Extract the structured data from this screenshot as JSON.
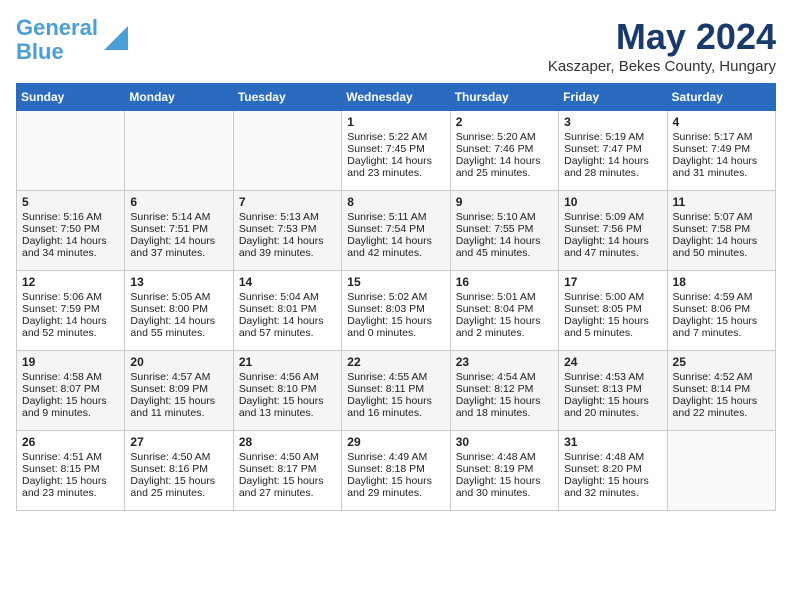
{
  "header": {
    "logo_line1": "General",
    "logo_line2": "Blue",
    "month_year": "May 2024",
    "location": "Kaszaper, Bekes County, Hungary"
  },
  "days_of_week": [
    "Sunday",
    "Monday",
    "Tuesday",
    "Wednesday",
    "Thursday",
    "Friday",
    "Saturday"
  ],
  "weeks": [
    [
      {
        "day": "",
        "sunrise": "",
        "sunset": "",
        "daylight": ""
      },
      {
        "day": "",
        "sunrise": "",
        "sunset": "",
        "daylight": ""
      },
      {
        "day": "",
        "sunrise": "",
        "sunset": "",
        "daylight": ""
      },
      {
        "day": "1",
        "sunrise": "Sunrise: 5:22 AM",
        "sunset": "Sunset: 7:45 PM",
        "daylight": "Daylight: 14 hours and 23 minutes."
      },
      {
        "day": "2",
        "sunrise": "Sunrise: 5:20 AM",
        "sunset": "Sunset: 7:46 PM",
        "daylight": "Daylight: 14 hours and 25 minutes."
      },
      {
        "day": "3",
        "sunrise": "Sunrise: 5:19 AM",
        "sunset": "Sunset: 7:47 PM",
        "daylight": "Daylight: 14 hours and 28 minutes."
      },
      {
        "day": "4",
        "sunrise": "Sunrise: 5:17 AM",
        "sunset": "Sunset: 7:49 PM",
        "daylight": "Daylight: 14 hours and 31 minutes."
      }
    ],
    [
      {
        "day": "5",
        "sunrise": "Sunrise: 5:16 AM",
        "sunset": "Sunset: 7:50 PM",
        "daylight": "Daylight: 14 hours and 34 minutes."
      },
      {
        "day": "6",
        "sunrise": "Sunrise: 5:14 AM",
        "sunset": "Sunset: 7:51 PM",
        "daylight": "Daylight: 14 hours and 37 minutes."
      },
      {
        "day": "7",
        "sunrise": "Sunrise: 5:13 AM",
        "sunset": "Sunset: 7:53 PM",
        "daylight": "Daylight: 14 hours and 39 minutes."
      },
      {
        "day": "8",
        "sunrise": "Sunrise: 5:11 AM",
        "sunset": "Sunset: 7:54 PM",
        "daylight": "Daylight: 14 hours and 42 minutes."
      },
      {
        "day": "9",
        "sunrise": "Sunrise: 5:10 AM",
        "sunset": "Sunset: 7:55 PM",
        "daylight": "Daylight: 14 hours and 45 minutes."
      },
      {
        "day": "10",
        "sunrise": "Sunrise: 5:09 AM",
        "sunset": "Sunset: 7:56 PM",
        "daylight": "Daylight: 14 hours and 47 minutes."
      },
      {
        "day": "11",
        "sunrise": "Sunrise: 5:07 AM",
        "sunset": "Sunset: 7:58 PM",
        "daylight": "Daylight: 14 hours and 50 minutes."
      }
    ],
    [
      {
        "day": "12",
        "sunrise": "Sunrise: 5:06 AM",
        "sunset": "Sunset: 7:59 PM",
        "daylight": "Daylight: 14 hours and 52 minutes."
      },
      {
        "day": "13",
        "sunrise": "Sunrise: 5:05 AM",
        "sunset": "Sunset: 8:00 PM",
        "daylight": "Daylight: 14 hours and 55 minutes."
      },
      {
        "day": "14",
        "sunrise": "Sunrise: 5:04 AM",
        "sunset": "Sunset: 8:01 PM",
        "daylight": "Daylight: 14 hours and 57 minutes."
      },
      {
        "day": "15",
        "sunrise": "Sunrise: 5:02 AM",
        "sunset": "Sunset: 8:03 PM",
        "daylight": "Daylight: 15 hours and 0 minutes."
      },
      {
        "day": "16",
        "sunrise": "Sunrise: 5:01 AM",
        "sunset": "Sunset: 8:04 PM",
        "daylight": "Daylight: 15 hours and 2 minutes."
      },
      {
        "day": "17",
        "sunrise": "Sunrise: 5:00 AM",
        "sunset": "Sunset: 8:05 PM",
        "daylight": "Daylight: 15 hours and 5 minutes."
      },
      {
        "day": "18",
        "sunrise": "Sunrise: 4:59 AM",
        "sunset": "Sunset: 8:06 PM",
        "daylight": "Daylight: 15 hours and 7 minutes."
      }
    ],
    [
      {
        "day": "19",
        "sunrise": "Sunrise: 4:58 AM",
        "sunset": "Sunset: 8:07 PM",
        "daylight": "Daylight: 15 hours and 9 minutes."
      },
      {
        "day": "20",
        "sunrise": "Sunrise: 4:57 AM",
        "sunset": "Sunset: 8:09 PM",
        "daylight": "Daylight: 15 hours and 11 minutes."
      },
      {
        "day": "21",
        "sunrise": "Sunrise: 4:56 AM",
        "sunset": "Sunset: 8:10 PM",
        "daylight": "Daylight: 15 hours and 13 minutes."
      },
      {
        "day": "22",
        "sunrise": "Sunrise: 4:55 AM",
        "sunset": "Sunset: 8:11 PM",
        "daylight": "Daylight: 15 hours and 16 minutes."
      },
      {
        "day": "23",
        "sunrise": "Sunrise: 4:54 AM",
        "sunset": "Sunset: 8:12 PM",
        "daylight": "Daylight: 15 hours and 18 minutes."
      },
      {
        "day": "24",
        "sunrise": "Sunrise: 4:53 AM",
        "sunset": "Sunset: 8:13 PM",
        "daylight": "Daylight: 15 hours and 20 minutes."
      },
      {
        "day": "25",
        "sunrise": "Sunrise: 4:52 AM",
        "sunset": "Sunset: 8:14 PM",
        "daylight": "Daylight: 15 hours and 22 minutes."
      }
    ],
    [
      {
        "day": "26",
        "sunrise": "Sunrise: 4:51 AM",
        "sunset": "Sunset: 8:15 PM",
        "daylight": "Daylight: 15 hours and 23 minutes."
      },
      {
        "day": "27",
        "sunrise": "Sunrise: 4:50 AM",
        "sunset": "Sunset: 8:16 PM",
        "daylight": "Daylight: 15 hours and 25 minutes."
      },
      {
        "day": "28",
        "sunrise": "Sunrise: 4:50 AM",
        "sunset": "Sunset: 8:17 PM",
        "daylight": "Daylight: 15 hours and 27 minutes."
      },
      {
        "day": "29",
        "sunrise": "Sunrise: 4:49 AM",
        "sunset": "Sunset: 8:18 PM",
        "daylight": "Daylight: 15 hours and 29 minutes."
      },
      {
        "day": "30",
        "sunrise": "Sunrise: 4:48 AM",
        "sunset": "Sunset: 8:19 PM",
        "daylight": "Daylight: 15 hours and 30 minutes."
      },
      {
        "day": "31",
        "sunrise": "Sunrise: 4:48 AM",
        "sunset": "Sunset: 8:20 PM",
        "daylight": "Daylight: 15 hours and 32 minutes."
      },
      {
        "day": "",
        "sunrise": "",
        "sunset": "",
        "daylight": ""
      }
    ]
  ]
}
